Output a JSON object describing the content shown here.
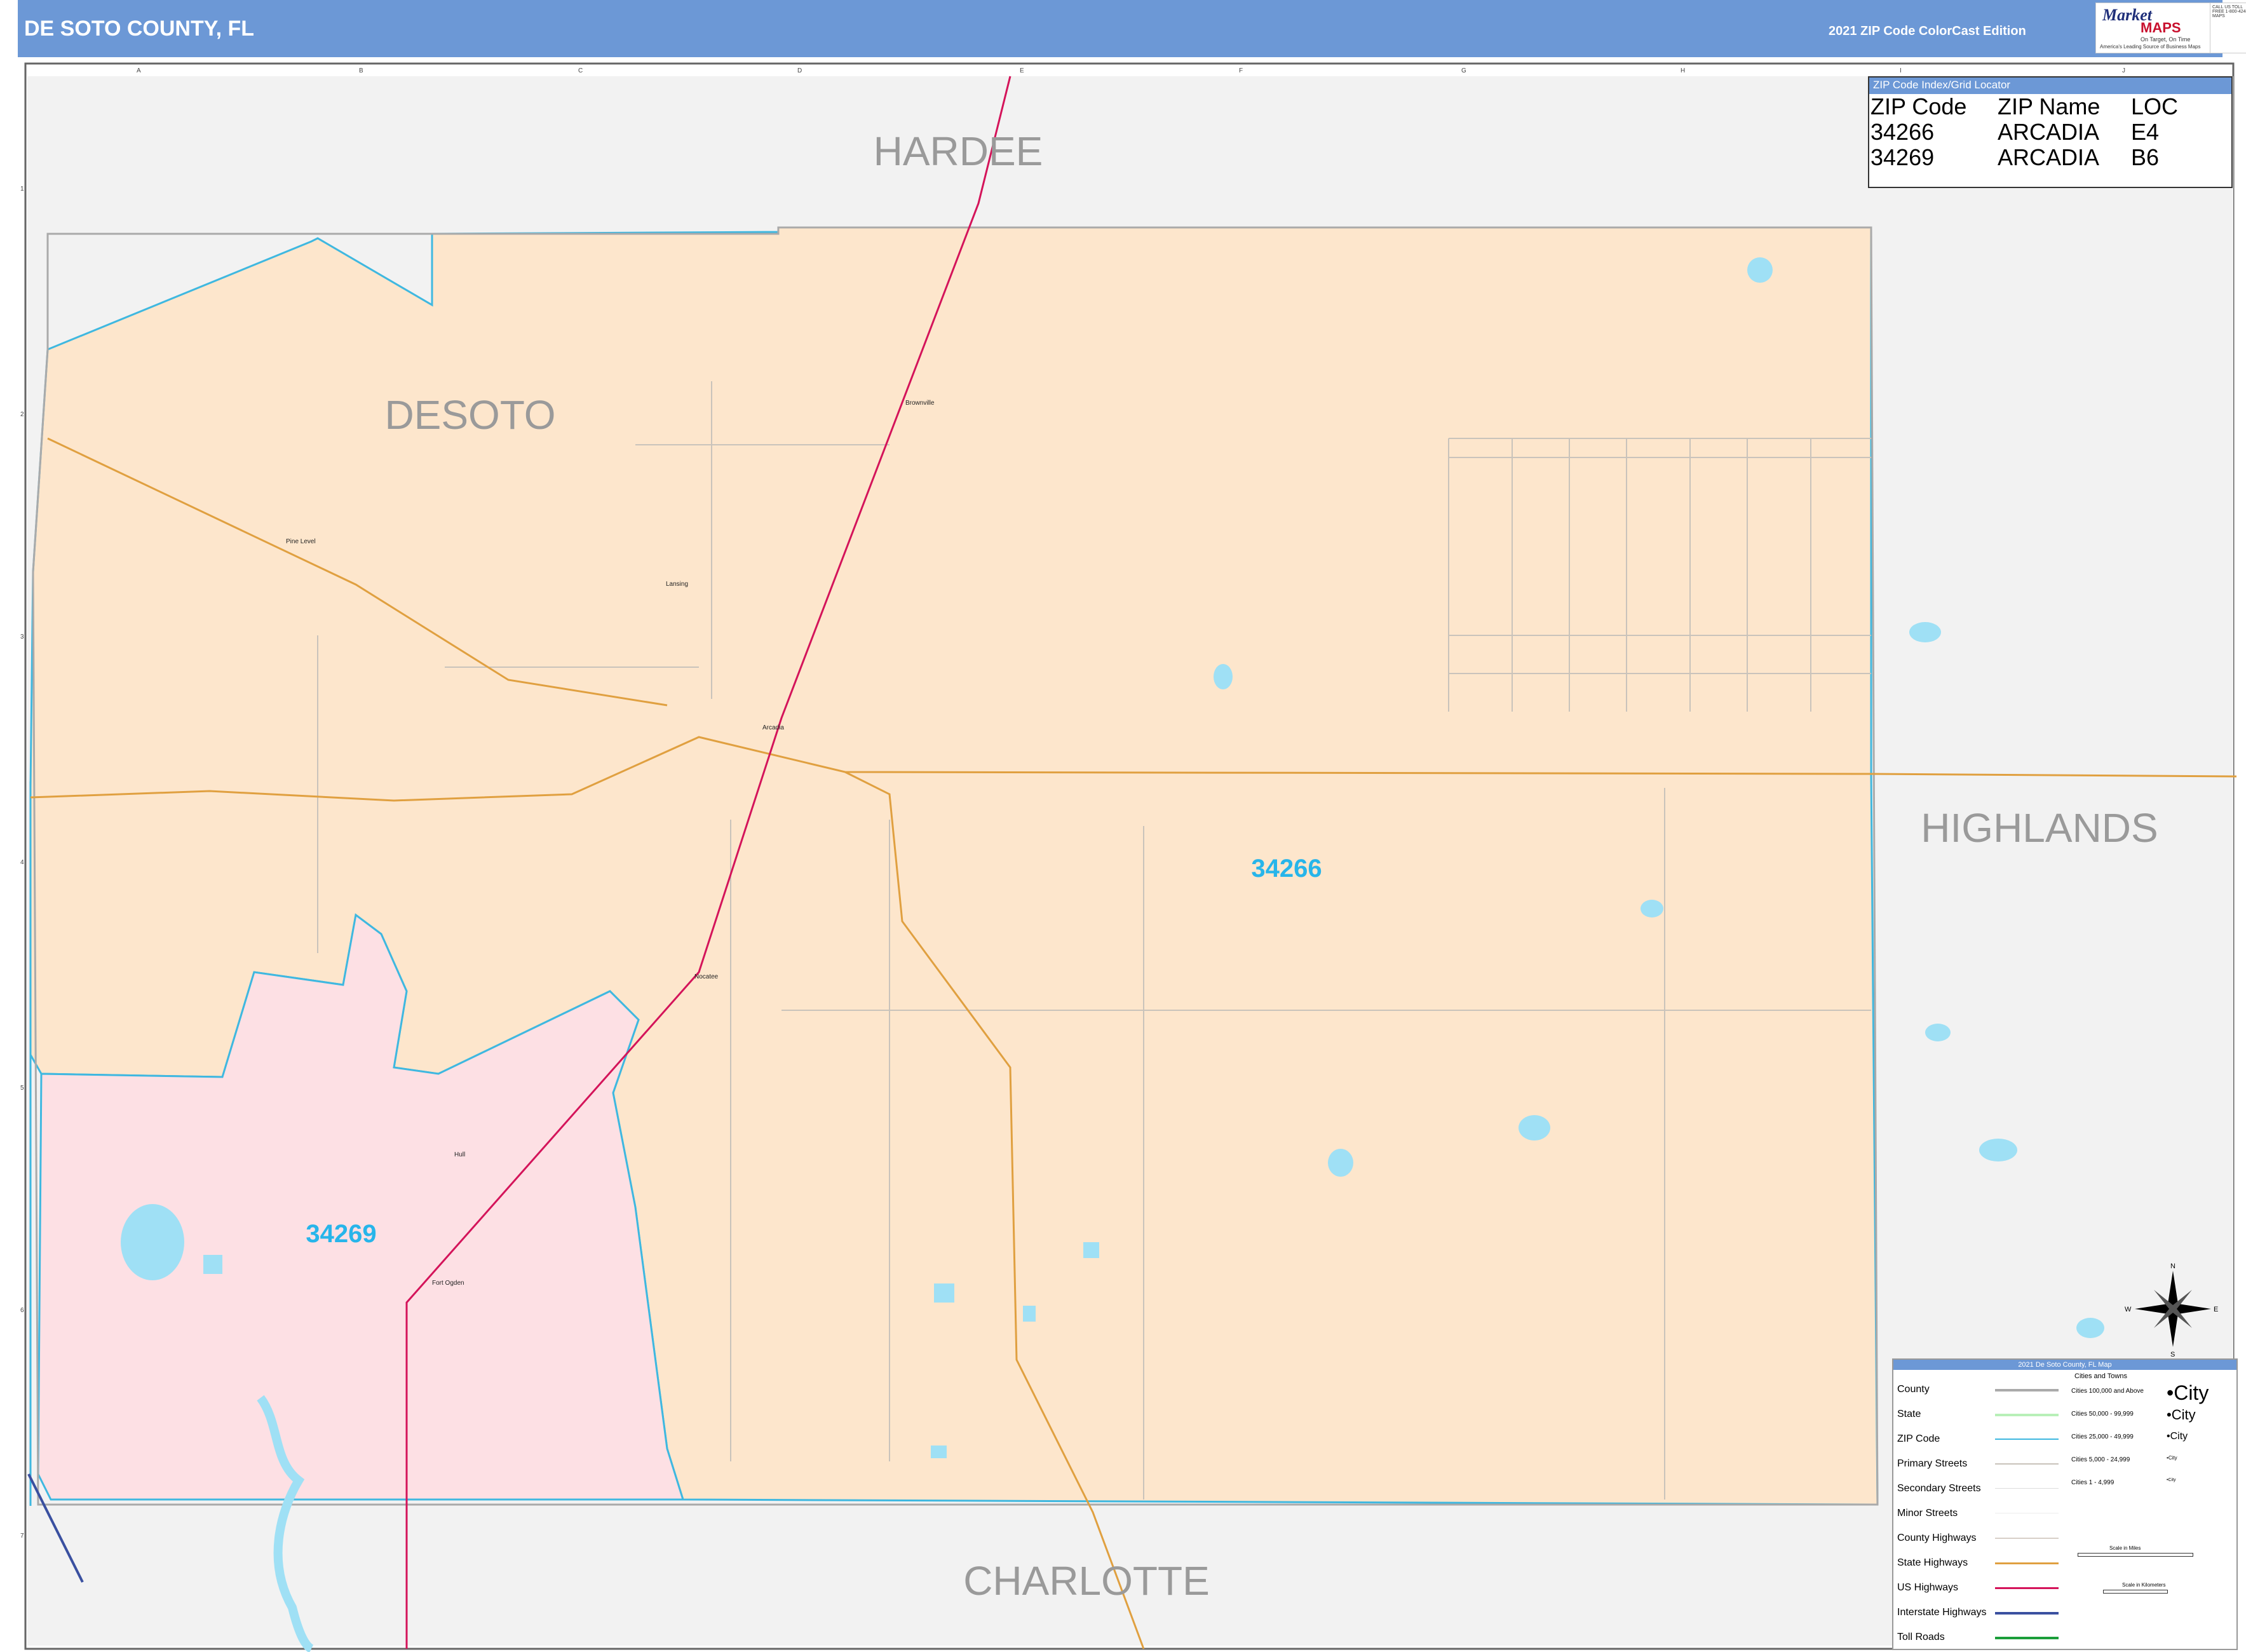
{
  "header": {
    "title": "DE SOTO COUNTY, FL",
    "edition": "2021 ZIP Code ColorCast Edition"
  },
  "logo": {
    "brand": "Market",
    "brand2": "MAPS",
    "tagline": "On Target, On Time",
    "tagline2": "America's Leading Source of Business Maps",
    "contact": "CALL US TOLL FREE 1-800-424-MAPS"
  },
  "grid": {
    "columns": [
      "A",
      "B",
      "C",
      "D",
      "E",
      "F",
      "G",
      "H",
      "I",
      "J"
    ],
    "rows": [
      "1",
      "2",
      "3",
      "4",
      "5",
      "6",
      "7"
    ]
  },
  "regions": {
    "hardee": "HARDEE",
    "desoto": "DESOTO",
    "highlands": "HIGHLANDS",
    "charlotte": "CHARLOTTE"
  },
  "zips": {
    "zip_34266": "34266",
    "zip_34269": "34269"
  },
  "places": {
    "brownville": "Brownville",
    "pine_level": "Pine Level",
    "lansing": "Lansing",
    "arcadia": "Arcadia",
    "nocatee": "Nocatee",
    "hull": "Hull",
    "fort_ogden": "Fort Ogden"
  },
  "index": {
    "title": "ZIP Code Index/Grid Locator",
    "headers": [
      "ZIP Code",
      "ZIP Name",
      "LOC"
    ],
    "rows": [
      [
        "34266",
        "ARCADIA",
        "E4"
      ],
      [
        "34269",
        "ARCADIA",
        "B6"
      ]
    ]
  },
  "legend": {
    "title": "2021 De Soto County, FL Map",
    "items": [
      "County",
      "State",
      "ZIP Code",
      "Primary Streets",
      "Secondary Streets",
      "Minor Streets",
      "County Highways",
      "State Highways",
      "US Highways",
      "Interstate Highways",
      "Toll Roads"
    ],
    "cities_title": "Cities and Towns",
    "city_classes": [
      "Cities 100,000 and Above",
      "Cities 50,000 - 99,999",
      "Cities 25,000 - 49,999",
      "Cities 5,000 - 24,999",
      "Cities 1 - 4,999"
    ],
    "city_glyph": "City",
    "scale_miles": "Scale in Miles",
    "scale_km": "Scale in Kilometers"
  },
  "compass": {
    "n": "N",
    "s": "S",
    "e": "E",
    "w": "W"
  },
  "colors": {
    "zip_34266": "#fde6cc",
    "zip_34269": "#fde0e4",
    "outside": "#f2f2f2",
    "zip_line": "#3fb8e0",
    "water": "#9fe0f5",
    "us_highway": "#d4145a",
    "state_highway": "#e0a040",
    "zip_label": "#27b5ea",
    "county_label": "#9a9a9a"
  }
}
